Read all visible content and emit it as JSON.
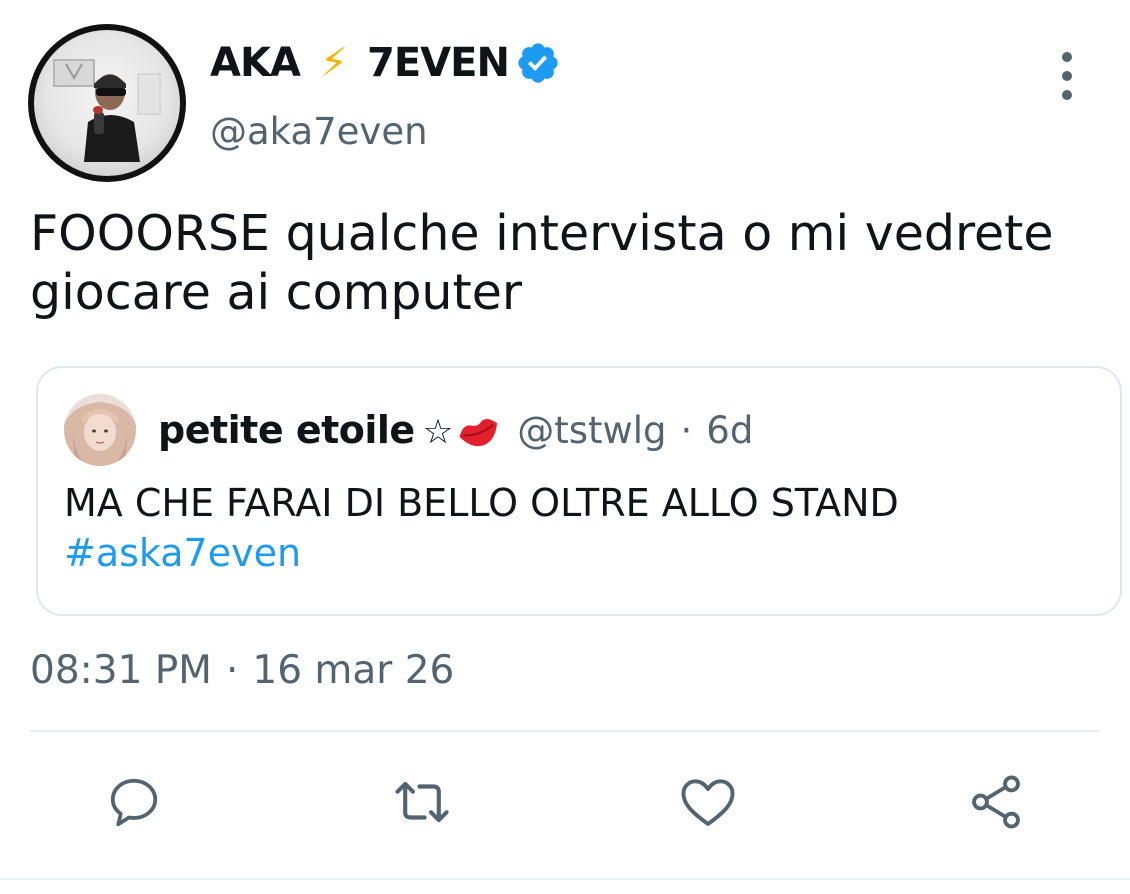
{
  "author": {
    "name_part1": "AKA",
    "bolt": "⚡",
    "name_part2": "7EVEN",
    "handle": "@aka7even",
    "verified": true
  },
  "tweet": {
    "text": "FOOORSE qualche intervista o mi vedrete giocare ai computer",
    "time": "08:31 PM",
    "separator": "·",
    "date": "16 mar 26"
  },
  "quoted": {
    "name": "petite etoile",
    "emoji_star": "☆",
    "emoji_icon": "lips-icon",
    "handle": "@tstwlg",
    "separator": "·",
    "age": "6d",
    "text": "MA CHE FARAI DI BELLO OLTRE ALLO STAND",
    "hashtag": "#aska7even"
  },
  "actions": [
    {
      "icon": "reply-icon"
    },
    {
      "icon": "retweet-icon"
    },
    {
      "icon": "like-icon"
    },
    {
      "icon": "share-icon"
    }
  ],
  "colors": {
    "text": "#0f1419",
    "secondary": "#536471",
    "accent": "#1d9bf0",
    "bolt": "#f5b400",
    "border": "#e1e8ed"
  }
}
